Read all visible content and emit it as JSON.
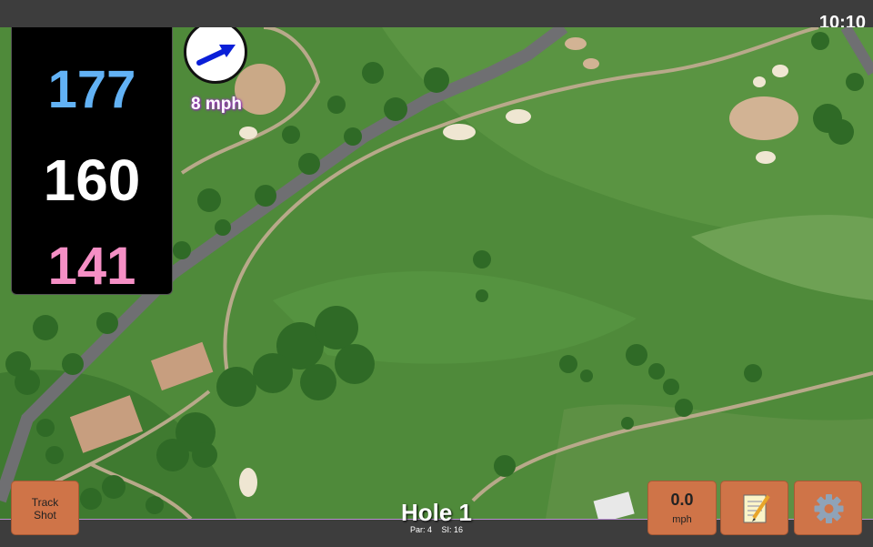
{
  "status": {
    "time": "10:10"
  },
  "distances": {
    "back": "177",
    "center": "160",
    "front": "141"
  },
  "wind": {
    "speed_label": "8 mph",
    "icon": "wind-direction-arrow-icon"
  },
  "buttons": {
    "track_shot_line1": "Track",
    "track_shot_line2": "Shot",
    "speed_value": "0.0",
    "speed_unit": "mph",
    "notes_icon": "notepad-icon",
    "settings_icon": "gear-icon"
  },
  "hole": {
    "title": "Hole 1",
    "par": "Par: 4",
    "si": "SI: 16"
  },
  "colors": {
    "back": "#62b2f5",
    "center": "#ffffff",
    "front": "#f58fc5",
    "button": "#cf7448",
    "accent_border": "#b98ed0"
  }
}
